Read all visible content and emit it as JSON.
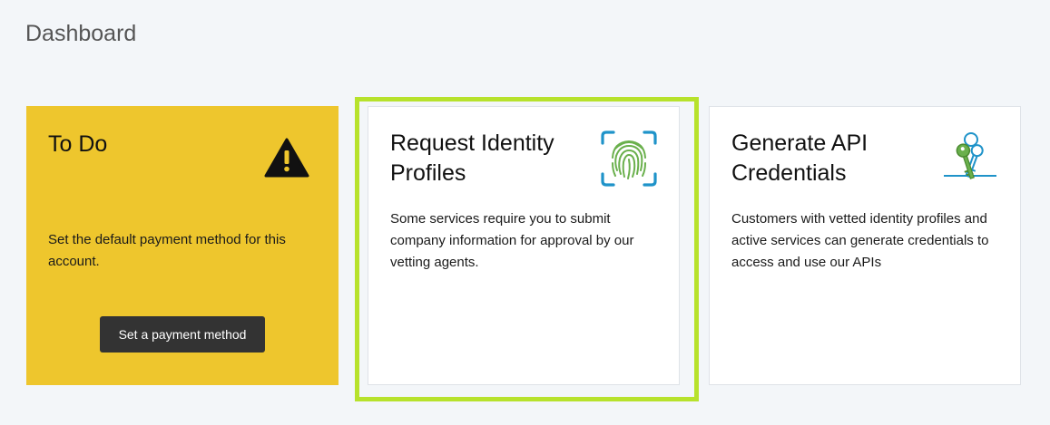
{
  "page": {
    "title": "Dashboard"
  },
  "todo_card": {
    "title": "To Do",
    "icon": "warning-icon",
    "text": "Set the default payment method for this account.",
    "button_label": "Set a payment method",
    "background": "#eec62d"
  },
  "identity_card": {
    "title": "Request Identity Profiles",
    "icon": "fingerprint-icon",
    "text": "Some services require you to submit company information for approval by our vetting agents.",
    "highlight_color": "#b7e22c"
  },
  "api_card": {
    "title": "Generate API Credentials",
    "icon": "keys-icon",
    "text": "Customers with vetted identity profiles and active services can generate credentials to access and use our APIs"
  }
}
